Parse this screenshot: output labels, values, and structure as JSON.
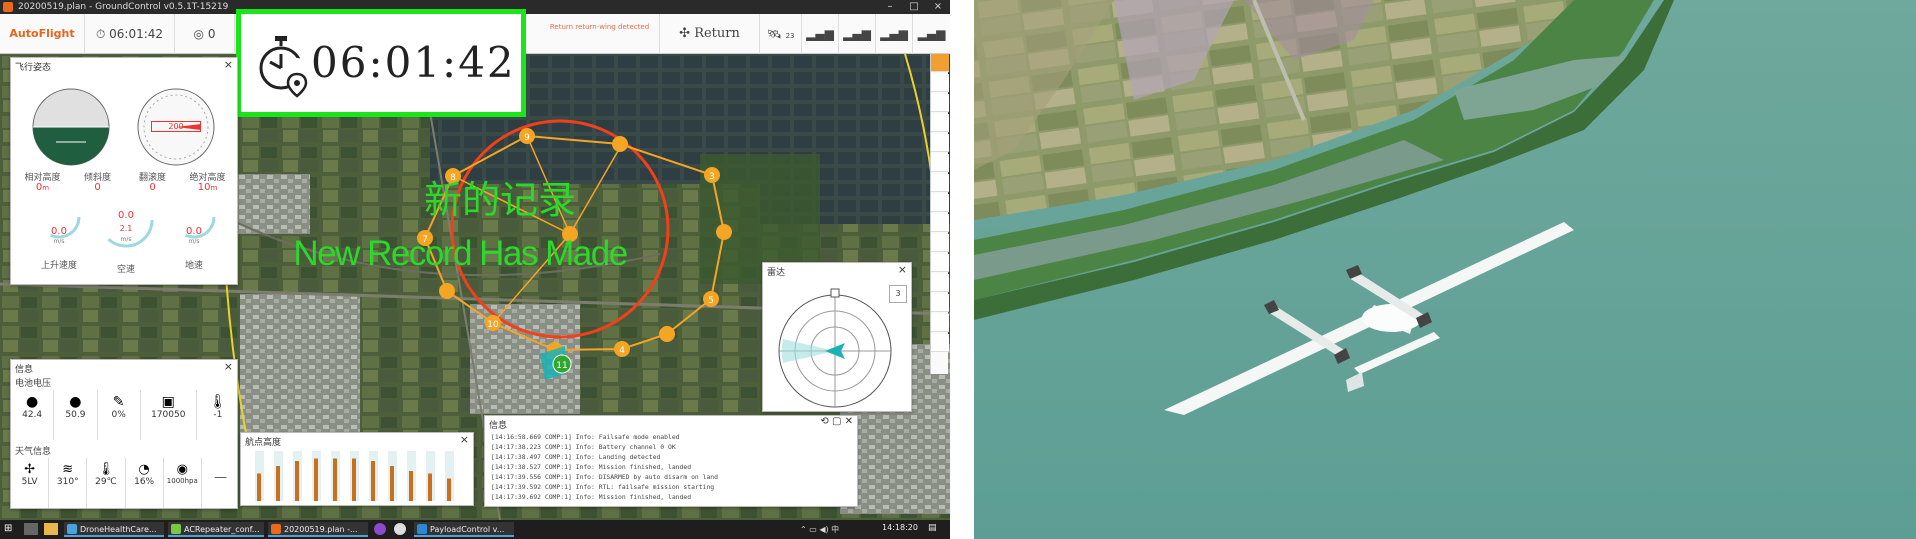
{
  "titlebar": {
    "title": "20200519.plan - GroundControl v0.5.1T-15219"
  },
  "toolbar": {
    "logo": "AutoFlight",
    "timer_small": "06:01:42",
    "count": "0",
    "status_warning": "Return return-wing detected",
    "return_label": "Return",
    "satellite_count": "23"
  },
  "timer_box": {
    "value": "06:01:42"
  },
  "record": {
    "zh": "新的记录",
    "en": "New Record Has Made"
  },
  "attitude": {
    "title": "飞行姿态",
    "labels": [
      "相对高度",
      "倾斜度",
      "翻滚度",
      "绝对高度"
    ],
    "values": [
      "0",
      "0",
      "0",
      "10"
    ],
    "units": [
      "m",
      "",
      "",
      "m"
    ],
    "heading": "200",
    "speed_labels": [
      "上升速度",
      "空速",
      "地速"
    ],
    "speed_values": [
      "0.0",
      "0.0",
      "0.0"
    ],
    "speed_units": [
      "m/s",
      "m/s",
      "m/s"
    ],
    "ground_speed": "2.1"
  },
  "info": {
    "title": "信息",
    "battery_label": "电池电压",
    "battery_cells": [
      "42.4",
      "50.9",
      "0%",
      "170050",
      "-1"
    ],
    "weather_label": "天气信息",
    "weather_cells": [
      "5LV",
      "310°",
      "29℃",
      "16%",
      "1000hpa",
      "—"
    ]
  },
  "altitude_chart": {
    "title": "航点高度",
    "values": [
      55,
      70,
      80,
      85,
      85,
      85,
      80,
      70,
      60,
      55,
      45
    ]
  },
  "radar": {
    "title": "雷达",
    "scale": "3"
  },
  "log": {
    "title": "信息",
    "lines": [
      "[14:16:58.669 COMP:1] Info: Failsafe mode enabled",
      "[14:17:38.223 COMP:1] Info: Battery channel 0 OK",
      "[14:17:38.497 COMP:1] Info: Landing detected",
      "[14:17:38.527 COMP:1] Info: Mission finished, landed",
      "[14:17:39.556 COMP:1] Info: DISARMED by auto disarm on land",
      "[14:17:39.592 COMP:1] Info: RTL: failsafe mission starting",
      "[14:17:39.692 COMP:1] Info: Mission finished, landed"
    ]
  },
  "taskbar": {
    "items": [
      "DroneHealthCare...",
      "ACRepeater_conf...",
      "20200519.plan -...",
      "PayloadControl v..."
    ],
    "clock": "14:18:20",
    "accent": "#4aa3df"
  },
  "colors": {
    "timer_border": "#19e619",
    "record_text": "#2bd82b",
    "route_orange": "#f5a524",
    "geofence_red": "#f2401b",
    "radar_teal": "#19b3b3"
  },
  "waypoint_labels": [
    "9",
    "8",
    "7",
    "10",
    "4",
    "5",
    "3",
    "11"
  ]
}
